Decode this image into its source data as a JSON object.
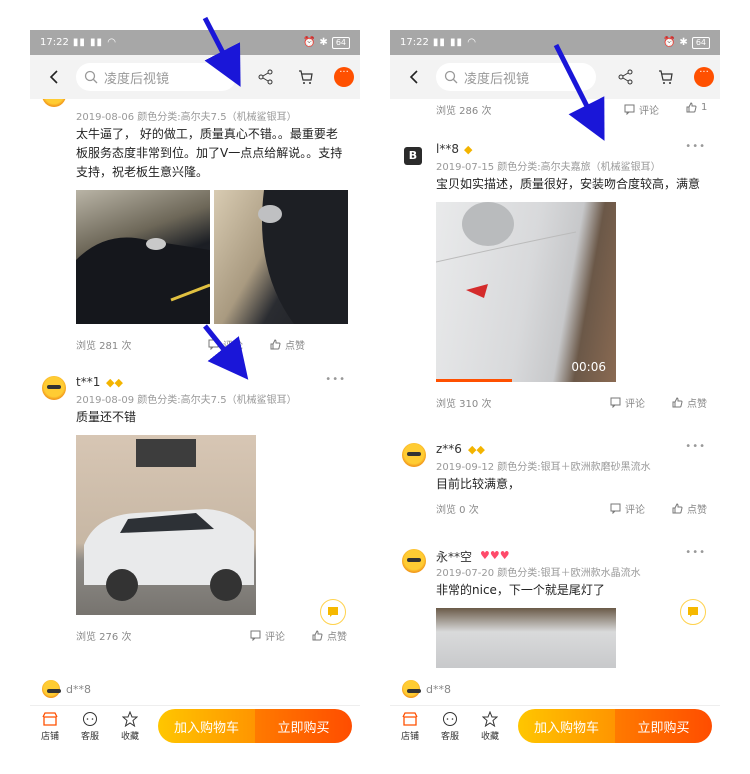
{
  "left": {
    "status": {
      "time": "17:22",
      "signal": "5al 5al",
      "battery": "64"
    },
    "search_placeholder": "凌度后视镜",
    "reviews": [
      {
        "date_variant": "2019-08-06 颜色分类:高尔夫7.5（机械鲨银耳）",
        "text": "太牛逼了，        好的做工，质量真心不错。。最重要老板服务态度非常到位。加了V一点点给解说。。支持支持，祝老板生意兴隆。",
        "views": "浏览 281 次",
        "comment": "评论",
        "like": "点赞"
      },
      {
        "user": "t**1",
        "badge": "◆◆",
        "date_variant": "2019-08-09 颜色分类:高尔夫7.5（机械鲨银耳）",
        "text": "质量还不错",
        "views": "浏览 276 次",
        "comment": "评论",
        "like": "点赞"
      }
    ],
    "next_user": "d**8"
  },
  "right": {
    "status": {
      "time": "17:22",
      "signal": "5al 5al",
      "battery": "64"
    },
    "search_placeholder": "凌度后视镜",
    "top_strip": {
      "views": "浏览 286 次",
      "comment": "评论",
      "like": "1"
    },
    "reviews": [
      {
        "user": "l**8",
        "badge": "◆",
        "date_variant": "2019-07-15 颜色分类:高尔夫嘉旅（机械鲨银耳）",
        "text": "宝贝如实描述，质量很好，安装吻合度较高，满意",
        "video_time": "00:06",
        "views": "浏览 310 次",
        "comment": "评论",
        "like": "点赞"
      },
      {
        "user": "z**6",
        "badge": "◆◆",
        "date_variant": "2019-09-12 颜色分类:银耳＋欧洲款磨砂黑流水",
        "text": "目前比较满意，",
        "views": "浏览 0 次",
        "comment": "评论",
        "like": "点赞"
      },
      {
        "user": "永**空",
        "badge": "♥♥♥",
        "date_variant": "2019-07-20 颜色分类:银耳＋欧洲款水晶流水",
        "text": "非常的nice，下一个就是尾灯了"
      }
    ],
    "next_user": "d**8"
  },
  "bottom": {
    "shop": "店铺",
    "service": "客服",
    "fav": "收藏",
    "cart": "加入购物车",
    "buy": "立即购买"
  },
  "colors": {
    "accent": "#ff5000",
    "annotation_arrow": "#1a16d8"
  }
}
